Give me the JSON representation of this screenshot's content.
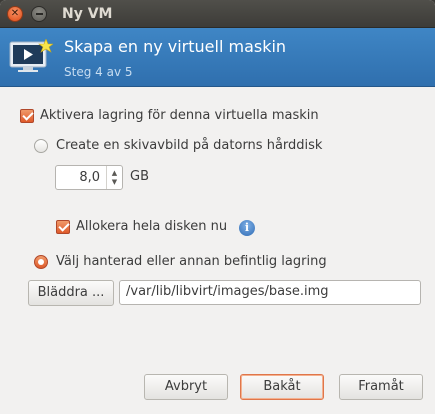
{
  "window": {
    "title": "Ny VM"
  },
  "header": {
    "title": "Skapa en ny virtuell maskin",
    "step": "Steg 4 av 5",
    "icon": "vm-monitor-icon"
  },
  "storage": {
    "enable_label": "Aktivera lagring för denna virtuella maskin",
    "enable_checked": true,
    "create_image_label": "Create en skivavbild på datorns hårddisk",
    "size_value": "8,0",
    "size_unit": "GB",
    "allocate_label": "Allokera hela disken nu",
    "allocate_checked": true,
    "managed_label": "Välj hanterad eller annan befintlig lagring",
    "selected_option": "managed",
    "browse_label": "Bläddra ...",
    "path_value": "/var/lib/libvirt/images/base.img"
  },
  "footer": {
    "cancel_label": "Avbryt",
    "back_label": "Bakåt",
    "forward_label": "Framåt"
  },
  "colors": {
    "header_blue": "#3577b8",
    "accent_orange": "#df5a2a",
    "titlebar": "#3d3c38"
  }
}
